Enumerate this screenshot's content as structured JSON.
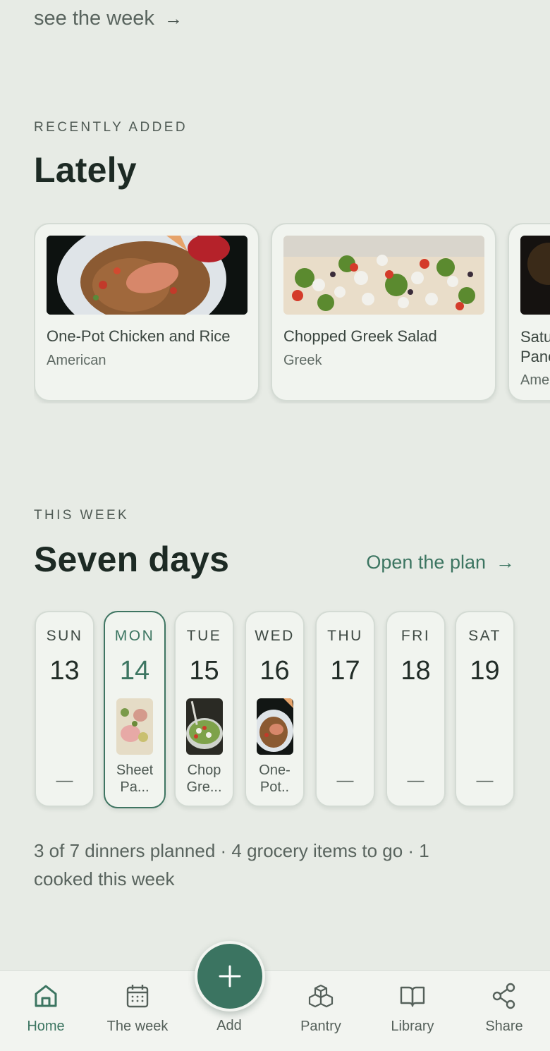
{
  "top_link": {
    "label": "see the week",
    "arrow": "→"
  },
  "recent": {
    "eyebrow": "RECENTLY ADDED",
    "title": "Lately",
    "cards": [
      {
        "title": "One-Pot Chicken and Rice",
        "cuisine": "American",
        "image": "chicken-rice-photo"
      },
      {
        "title": "Chopped Greek Salad",
        "cuisine": "Greek",
        "image": "greek-salad-photo"
      },
      {
        "title": "Satu",
        "title2": "Panc",
        "cuisine": "Ame",
        "image": "dark-dish-photo"
      }
    ]
  },
  "week": {
    "eyebrow": "THIS WEEK",
    "title": "Seven days",
    "open_plan": "Open the plan",
    "open_plan_arrow": "→",
    "days": [
      {
        "name": "SUN",
        "num": "13",
        "empty": "—"
      },
      {
        "name": "MON",
        "num": "14",
        "meal_line1": "Sheet",
        "meal_line2": "Pa...",
        "image": "sheet-pan-photo",
        "active": true
      },
      {
        "name": "TUE",
        "num": "15",
        "meal_line1": "Chop",
        "meal_line2": "Gre...",
        "image": "salad-bowl-photo"
      },
      {
        "name": "WED",
        "num": "16",
        "meal_line1": "One-",
        "meal_line2": "Pot..",
        "image": "chicken-rice-photo"
      },
      {
        "name": "THU",
        "num": "17",
        "empty": "—"
      },
      {
        "name": "FRI",
        "num": "18",
        "empty": "—"
      },
      {
        "name": "SAT",
        "num": "19",
        "empty": "—"
      }
    ],
    "summary": "3 of 7 dinners planned · 4 grocery items to go · 1 cooked this week"
  },
  "nav": {
    "items": [
      {
        "label": "Home",
        "icon": "home-icon",
        "active": true
      },
      {
        "label": "The week",
        "icon": "calendar-icon"
      },
      {
        "label": "Add",
        "icon": "plus-icon"
      },
      {
        "label": "Pantry",
        "icon": "boxes-icon"
      },
      {
        "label": "Library",
        "icon": "book-icon"
      },
      {
        "label": "Share",
        "icon": "share-icon"
      }
    ]
  },
  "colors": {
    "accent": "#3b7461",
    "background": "#e7ebe5",
    "card": "#f1f4ef"
  }
}
